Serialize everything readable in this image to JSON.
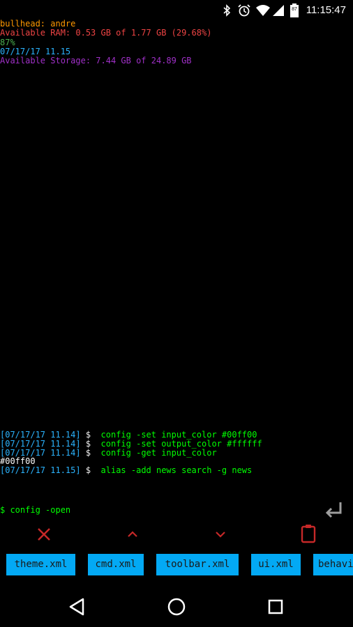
{
  "status_bar": {
    "time": "11:15:47",
    "battery_level": "87"
  },
  "info": {
    "device_user": "bullhead: andre",
    "ram": "Available RAM: 0.53 GB of 1.77 GB (29.68%)",
    "battery": "87%",
    "datetime": "07/17/17 11.15",
    "storage": "Available Storage: 7.44 GB of 24.89 GB"
  },
  "colors": {
    "device_user": "#ff9800",
    "ram": "#ef4444",
    "battery": "#4caf50",
    "datetime": "#2bb4ff",
    "storage": "#a030c8",
    "command": "#00ff00",
    "chip_bg": "#03a9f4"
  },
  "history": [
    {
      "timestamp": "[07/17/17 11.14]",
      "prompt": "$",
      "command": "config -set input_color #00ff00"
    },
    {
      "timestamp": "[07/17/17 11.14]",
      "prompt": "$",
      "command": "config -set output_color #ffffff"
    },
    {
      "timestamp": "[07/17/17 11.14]",
      "prompt": "$",
      "command": "config -get input_color"
    },
    {
      "output": "#00ff00"
    },
    {
      "timestamp": "[07/17/17 11.15]",
      "prompt": "$",
      "command": "alias -add news search -g news"
    }
  ],
  "input": {
    "text": "$ config -open"
  },
  "toolbar": {
    "icons": [
      "close-icon",
      "arrow-up-icon",
      "arrow-down-icon",
      "clipboard-icon"
    ]
  },
  "suggestions": [
    "theme.xml",
    "cmd.xml",
    "toolbar.xml",
    "ui.xml",
    "behavior.xml"
  ],
  "navbar": {
    "icons": [
      "back-icon",
      "home-icon",
      "recents-icon"
    ]
  }
}
